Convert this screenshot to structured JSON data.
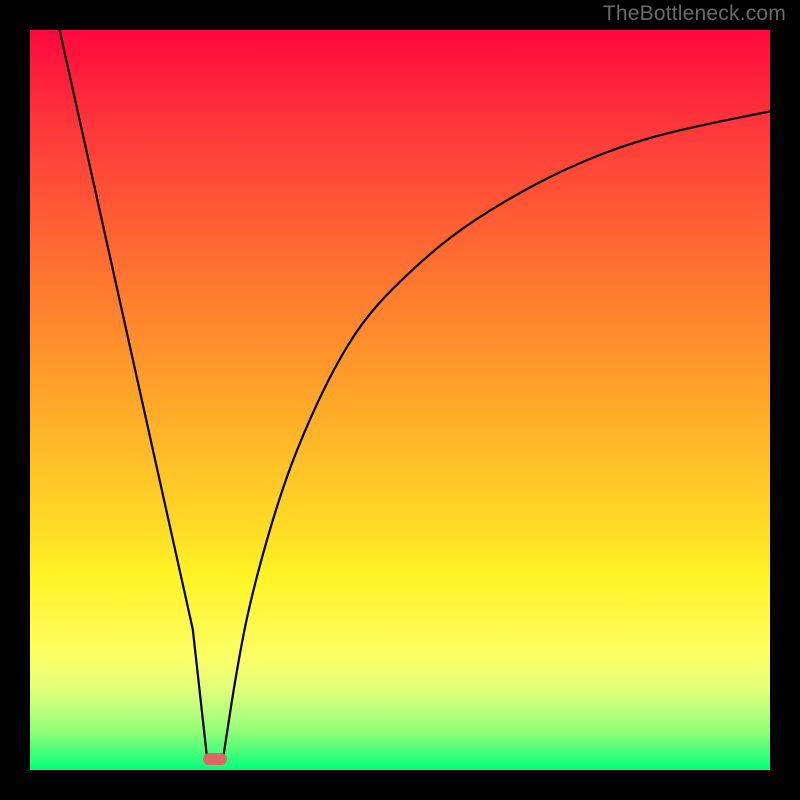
{
  "watermark": "TheBottleneck.com",
  "chart_data": {
    "type": "line",
    "title": "",
    "xlabel": "",
    "ylabel": "",
    "xlim": [
      0,
      100
    ],
    "ylim": [
      0,
      100
    ],
    "grid": false,
    "legend": false,
    "background_gradient": {
      "direction": "vertical",
      "stops": [
        {
          "pos": 0,
          "color": "#ff073e"
        },
        {
          "pos": 50,
          "color": "#ffbb28"
        },
        {
          "pos": 80,
          "color": "#fff94a"
        },
        {
          "pos": 100,
          "color": "#00ff7c"
        }
      ]
    },
    "series": [
      {
        "name": "left-branch",
        "x": [
          4,
          6,
          8,
          10,
          12,
          14,
          16,
          18,
          20,
          22,
          24
        ],
        "y": [
          100,
          91,
          82,
          73,
          64,
          55,
          46,
          37,
          28,
          19,
          1
        ]
      },
      {
        "name": "right-branch",
        "x": [
          26,
          28,
          30,
          34,
          38,
          42,
          46,
          52,
          58,
          66,
          74,
          82,
          90,
          100
        ],
        "y": [
          1,
          14,
          24,
          38,
          48,
          56,
          62,
          68,
          73,
          78,
          82,
          85,
          87,
          89
        ]
      }
    ],
    "marker": {
      "name": "bottleneck-point",
      "x": 25,
      "y": 1.5,
      "color": "#e06666"
    }
  }
}
